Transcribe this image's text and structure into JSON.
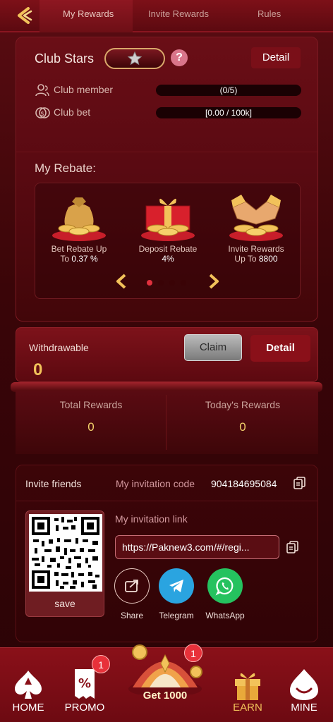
{
  "tabs": [
    {
      "label": "My Rewards",
      "active": true
    },
    {
      "label": "Invite Rewards",
      "active": false
    },
    {
      "label": "Rules",
      "active": false
    }
  ],
  "club": {
    "title": "Club Stars",
    "detail_label": "Detail",
    "member_label": "Club member",
    "member_value": "(0/5)",
    "bet_label": "Club bet",
    "bet_value": "[0.00 / 100k]",
    "rebate_title": "My Rebate:",
    "rebates": [
      {
        "line1": "Bet Rebate Up",
        "line2_prefix": "To ",
        "line2_value": "0.37 %"
      },
      {
        "line1": "Deposit Rebate",
        "line2_prefix": "",
        "line2_value": "4%"
      },
      {
        "line1": "Invite Rewards",
        "line2_prefix": "Up To ",
        "line2_value": "8800"
      }
    ],
    "active_dot": 0
  },
  "withdraw": {
    "label": "Withdrawable",
    "value": "0",
    "claim_label": "Claim",
    "detail_label": "Detail"
  },
  "totals": {
    "total_label": "Total Rewards",
    "total_value": "0",
    "today_label": "Today's Rewards",
    "today_value": "0"
  },
  "invite": {
    "title": "Invite friends",
    "code_label": "My invitation code",
    "code": "904184695084",
    "link_label": "My invitation link",
    "link": "https://Paknew3.com/#/regi...",
    "save_label": "save",
    "share": [
      {
        "label": "Share",
        "icon": "share-icon",
        "color": "#3a0508"
      },
      {
        "label": "Telegram",
        "icon": "telegram-icon",
        "color": "#2aa4e0"
      },
      {
        "label": "WhatsApp",
        "icon": "whatsapp-icon",
        "color": "#25c25f"
      }
    ]
  },
  "nav": {
    "home": "HOME",
    "promo": "PROMO",
    "promo_badge": "1",
    "center": "Get 1000",
    "center_badge": "1",
    "earn": "EARN",
    "mine": "MINE"
  },
  "colors": {
    "accent_gold": "#f2c25a",
    "primary_red": "#8a1019",
    "badge_red": "#e8313a"
  }
}
